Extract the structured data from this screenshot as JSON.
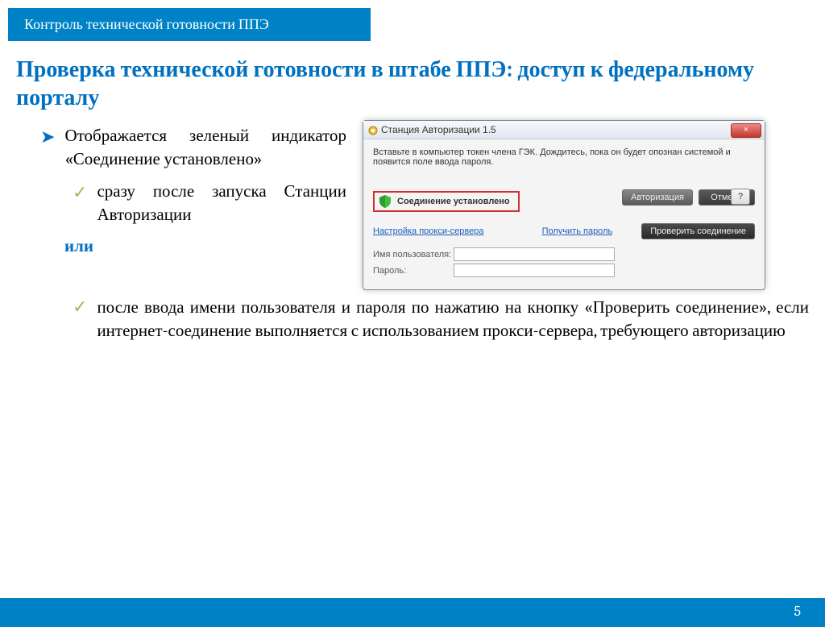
{
  "header": {
    "title": "Контроль технической готовности ППЭ"
  },
  "heading": "Проверка технической готовности в штабе ППЭ: доступ к федеральному порталу",
  "bullets": {
    "item1": "Отображается зеленый индикатор «Соединение установлено»",
    "sub1": "сразу после запуска Станции Авторизации",
    "or": "или",
    "sub2": "после ввода имени пользователя и пароля по нажатию на кнопку «Проверить соединение», если интернет-соединение выполняется с использованием прокси-сервера, требующего авторизацию"
  },
  "dialog": {
    "title": "Станция Авторизации 1.5",
    "close": "×",
    "instruction": "Вставьте в компьютер токен члена ГЭК. Дождитесь, пока он будет опознан системой и появится поле ввода пароля.",
    "help": "?",
    "connection": "Соединение установлено",
    "btn_auth": "Авторизация",
    "btn_cancel": "Отмена",
    "link_proxy": "Настройка прокси-сервера",
    "link_getpass": "Получить пароль",
    "btn_check": "Проверить соединение",
    "label_user": "Имя пользователя:",
    "label_pass": "Пароль:"
  },
  "footer": {
    "page": "5"
  }
}
